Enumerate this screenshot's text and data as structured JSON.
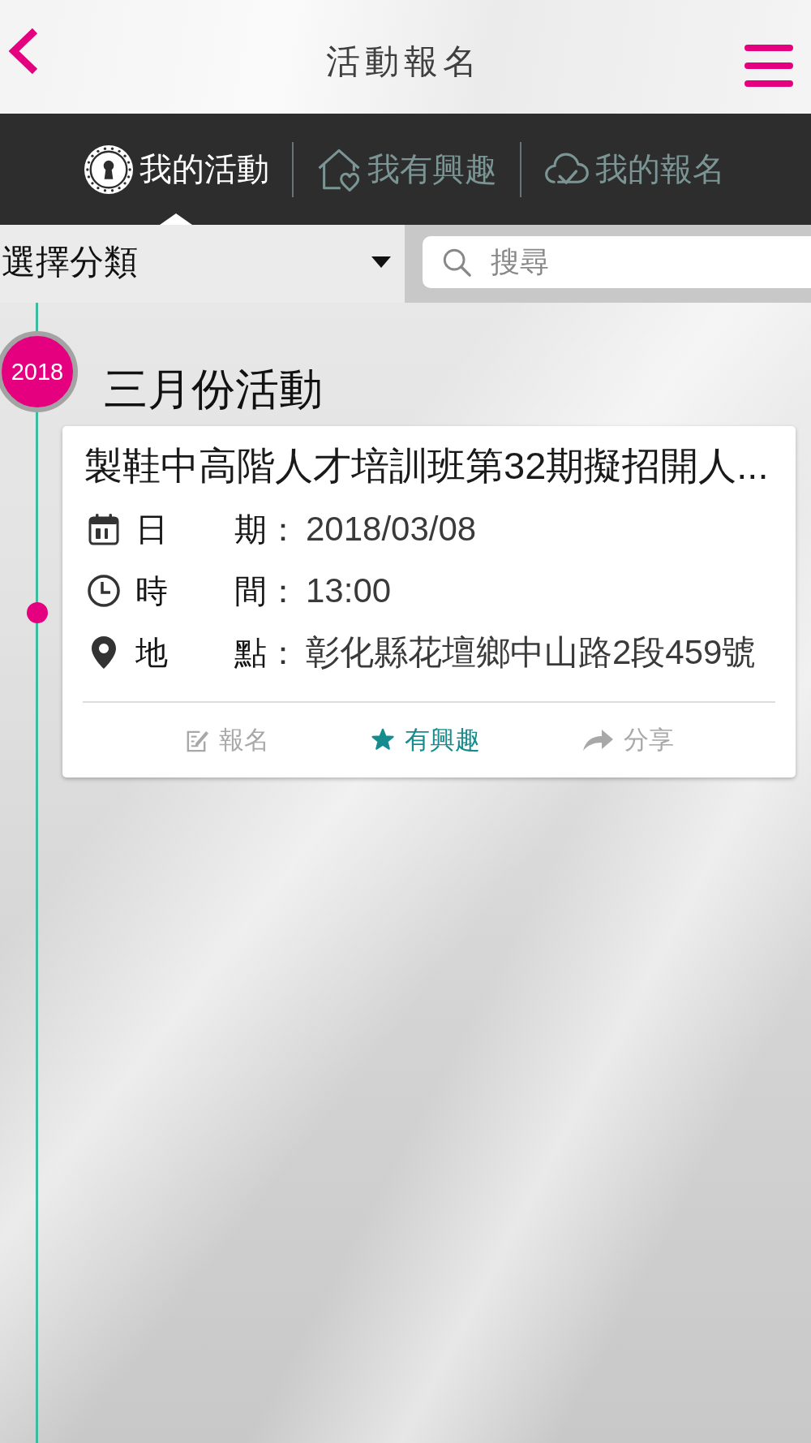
{
  "header": {
    "title": "活動報名"
  },
  "tabs": [
    {
      "label": "我的活動",
      "kind": "keyhole",
      "selected": true
    },
    {
      "label": "我有興趣",
      "kind": "house-heart",
      "selected": false
    },
    {
      "label": "我的報名",
      "kind": "cloud-check",
      "selected": false
    }
  ],
  "category_filter": {
    "label": "選擇分類"
  },
  "search": {
    "placeholder": "搜尋"
  },
  "timeline": [
    {
      "year": "2018",
      "month": "三月份活動",
      "events": [
        {
          "title": "製鞋中高階人才培訓班第32期擬招開人...",
          "details": [
            {
              "kind": "date",
              "label": "日 期",
              "separator": "：",
              "value": "2018/03/08"
            },
            {
              "kind": "time",
              "label": "時 間",
              "separator": "：",
              "value": "13:00"
            },
            {
              "kind": "place",
              "label": "地 點",
              "separator": "：",
              "value": "彰化縣花壇鄉中山路2段459號"
            }
          ],
          "actions": [
            {
              "kind": "signup",
              "label": "報名",
              "active": false
            },
            {
              "kind": "interest",
              "label": "有興趣",
              "active": true
            },
            {
              "kind": "share",
              "label": "分享",
              "active": false
            }
          ]
        }
      ]
    }
  ]
}
